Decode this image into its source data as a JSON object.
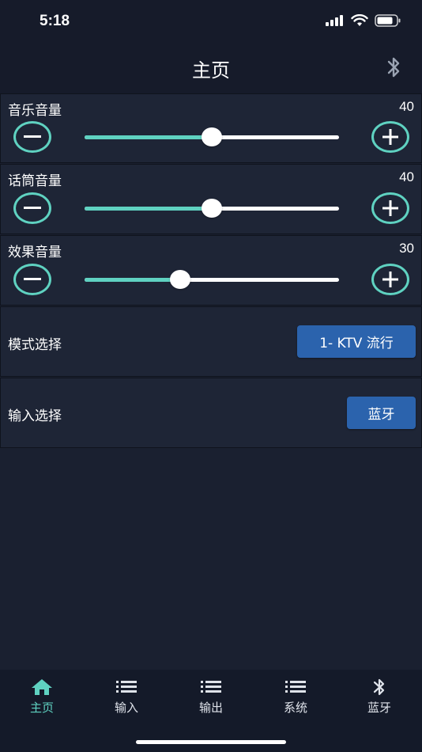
{
  "status_bar": {
    "time": "5:18"
  },
  "header": {
    "title": "主页",
    "right_icon": "bluetooth-icon"
  },
  "volumes": [
    {
      "label": "音乐音量",
      "value": "40",
      "level": 0.5
    },
    {
      "label": "话筒音量",
      "value": "40",
      "level": 0.5
    },
    {
      "label": "效果音量",
      "value": "30",
      "level": 0.375
    }
  ],
  "mode": {
    "label": "模式选择",
    "button": "1- KTV 流行"
  },
  "input": {
    "label": "输入选择",
    "button": "蓝牙"
  },
  "tabs": [
    {
      "label": "主页",
      "icon": "home-icon",
      "active": true
    },
    {
      "label": "输入",
      "icon": "list-icon",
      "active": false
    },
    {
      "label": "输出",
      "icon": "list-icon",
      "active": false
    },
    {
      "label": "系统",
      "icon": "list-icon",
      "active": false
    },
    {
      "label": "蓝牙",
      "icon": "bluetooth-icon",
      "active": false
    }
  ],
  "colors": {
    "accent": "#5fd2c1",
    "button_blue": "#2b63ad",
    "background": "#1a2030"
  }
}
